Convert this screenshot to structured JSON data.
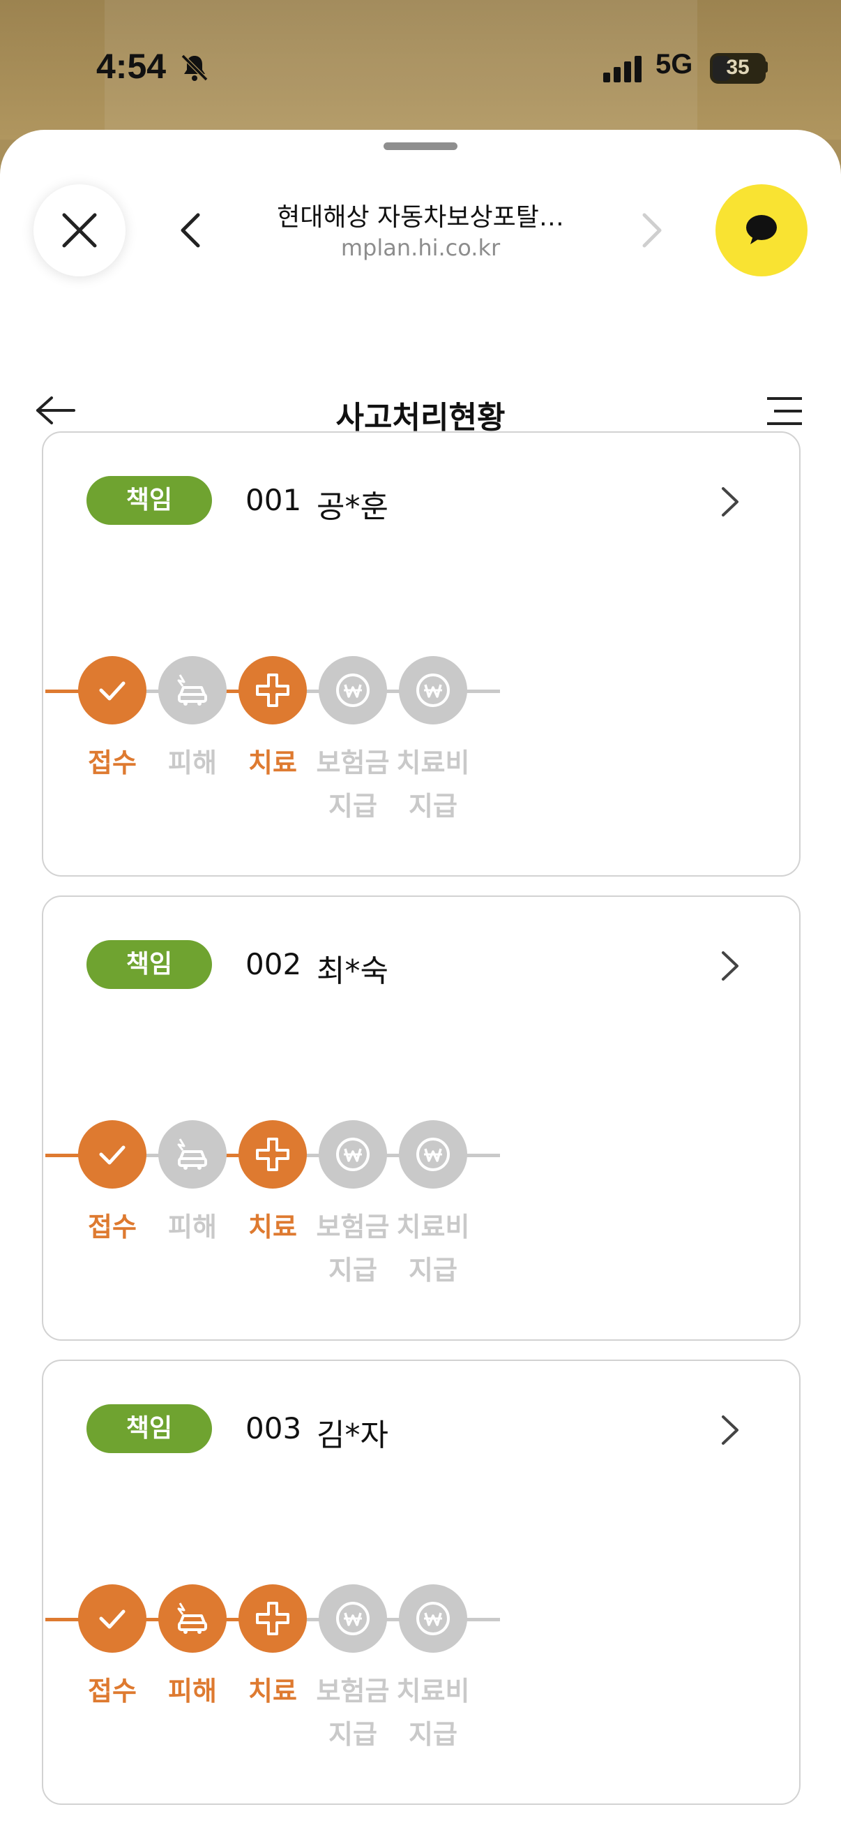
{
  "status_bar": {
    "time": "4:54",
    "network": "5G",
    "battery": "35"
  },
  "browser": {
    "title": "현대해상 자동차보상포탈…",
    "url": "mplan.hi.co.kr"
  },
  "page": {
    "title": "사고처리현황"
  },
  "colors": {
    "accent": "#de7a30",
    "inactive": "#c9c9c9",
    "badge": "#6fa330",
    "kakao_yellow": "#f9e332"
  },
  "step_labels": [
    "접수",
    "피해",
    "치료",
    "보험금\n지급",
    "치료비\n지급"
  ],
  "claims": [
    {
      "badge": "책임",
      "number": "001",
      "name": "공*훈",
      "steps": [
        {
          "label": "접수",
          "active": true,
          "icon": "check-icon"
        },
        {
          "label": "피해",
          "active": false,
          "icon": "car-crash-icon"
        },
        {
          "label": "치료",
          "active": true,
          "icon": "medical-cross-icon"
        },
        {
          "label": "보험금 지급",
          "active": false,
          "icon": "won-coin-icon"
        },
        {
          "label": "치료비 지급",
          "active": false,
          "icon": "won-coin-icon"
        }
      ]
    },
    {
      "badge": "책임",
      "number": "002",
      "name": "최*숙",
      "steps": [
        {
          "label": "접수",
          "active": true,
          "icon": "check-icon"
        },
        {
          "label": "피해",
          "active": false,
          "icon": "car-crash-icon"
        },
        {
          "label": "치료",
          "active": true,
          "icon": "medical-cross-icon"
        },
        {
          "label": "보험금 지급",
          "active": false,
          "icon": "won-coin-icon"
        },
        {
          "label": "치료비 지급",
          "active": false,
          "icon": "won-coin-icon"
        }
      ]
    },
    {
      "badge": "책임",
      "number": "003",
      "name": "김*자",
      "steps": [
        {
          "label": "접수",
          "active": true,
          "icon": "check-icon"
        },
        {
          "label": "피해",
          "active": true,
          "icon": "car-crash-icon"
        },
        {
          "label": "치료",
          "active": true,
          "icon": "medical-cross-icon"
        },
        {
          "label": "보험금 지급",
          "active": false,
          "icon": "won-coin-icon"
        },
        {
          "label": "치료비 지급",
          "active": false,
          "icon": "won-coin-icon"
        }
      ]
    }
  ]
}
